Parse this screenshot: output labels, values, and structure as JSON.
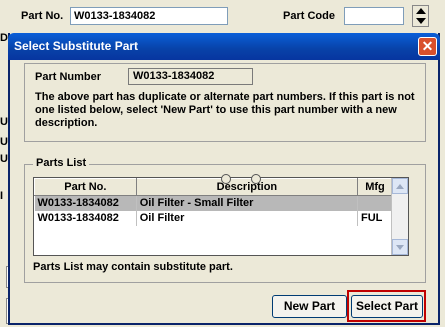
{
  "background": {
    "part_no_label": "Part No.",
    "part_no_value": "W0133-1834082",
    "part_code_label": "Part Code",
    "part_code_value": "",
    "side_letters": [
      "D",
      "U",
      "U",
      "U",
      "I"
    ]
  },
  "dialog": {
    "title": "Select Substitute Part",
    "close_glyph": "✕",
    "part_number_label": "Part Number",
    "part_number_value": "W0133-1834082",
    "message": "The above part has duplicate or alternate part numbers. If this part is not one listed below, select 'New Part' to use this part number with a new description.",
    "parts_list_label": "Parts List",
    "columns": [
      "Part No.",
      "Description",
      "Mfg"
    ],
    "rows": [
      {
        "part_no": "W0133-1834082",
        "description": "Oil Filter - Small Filter",
        "mfg": "",
        "selected": true
      },
      {
        "part_no": "W0133-1834082",
        "description": "Oil Filter",
        "mfg": "FUL",
        "selected": false
      }
    ],
    "parts_note": "Parts List may contain substitute part.",
    "new_part_label": "New Part",
    "select_part_label": "Select Part",
    "highlight_color": "#c00000"
  }
}
